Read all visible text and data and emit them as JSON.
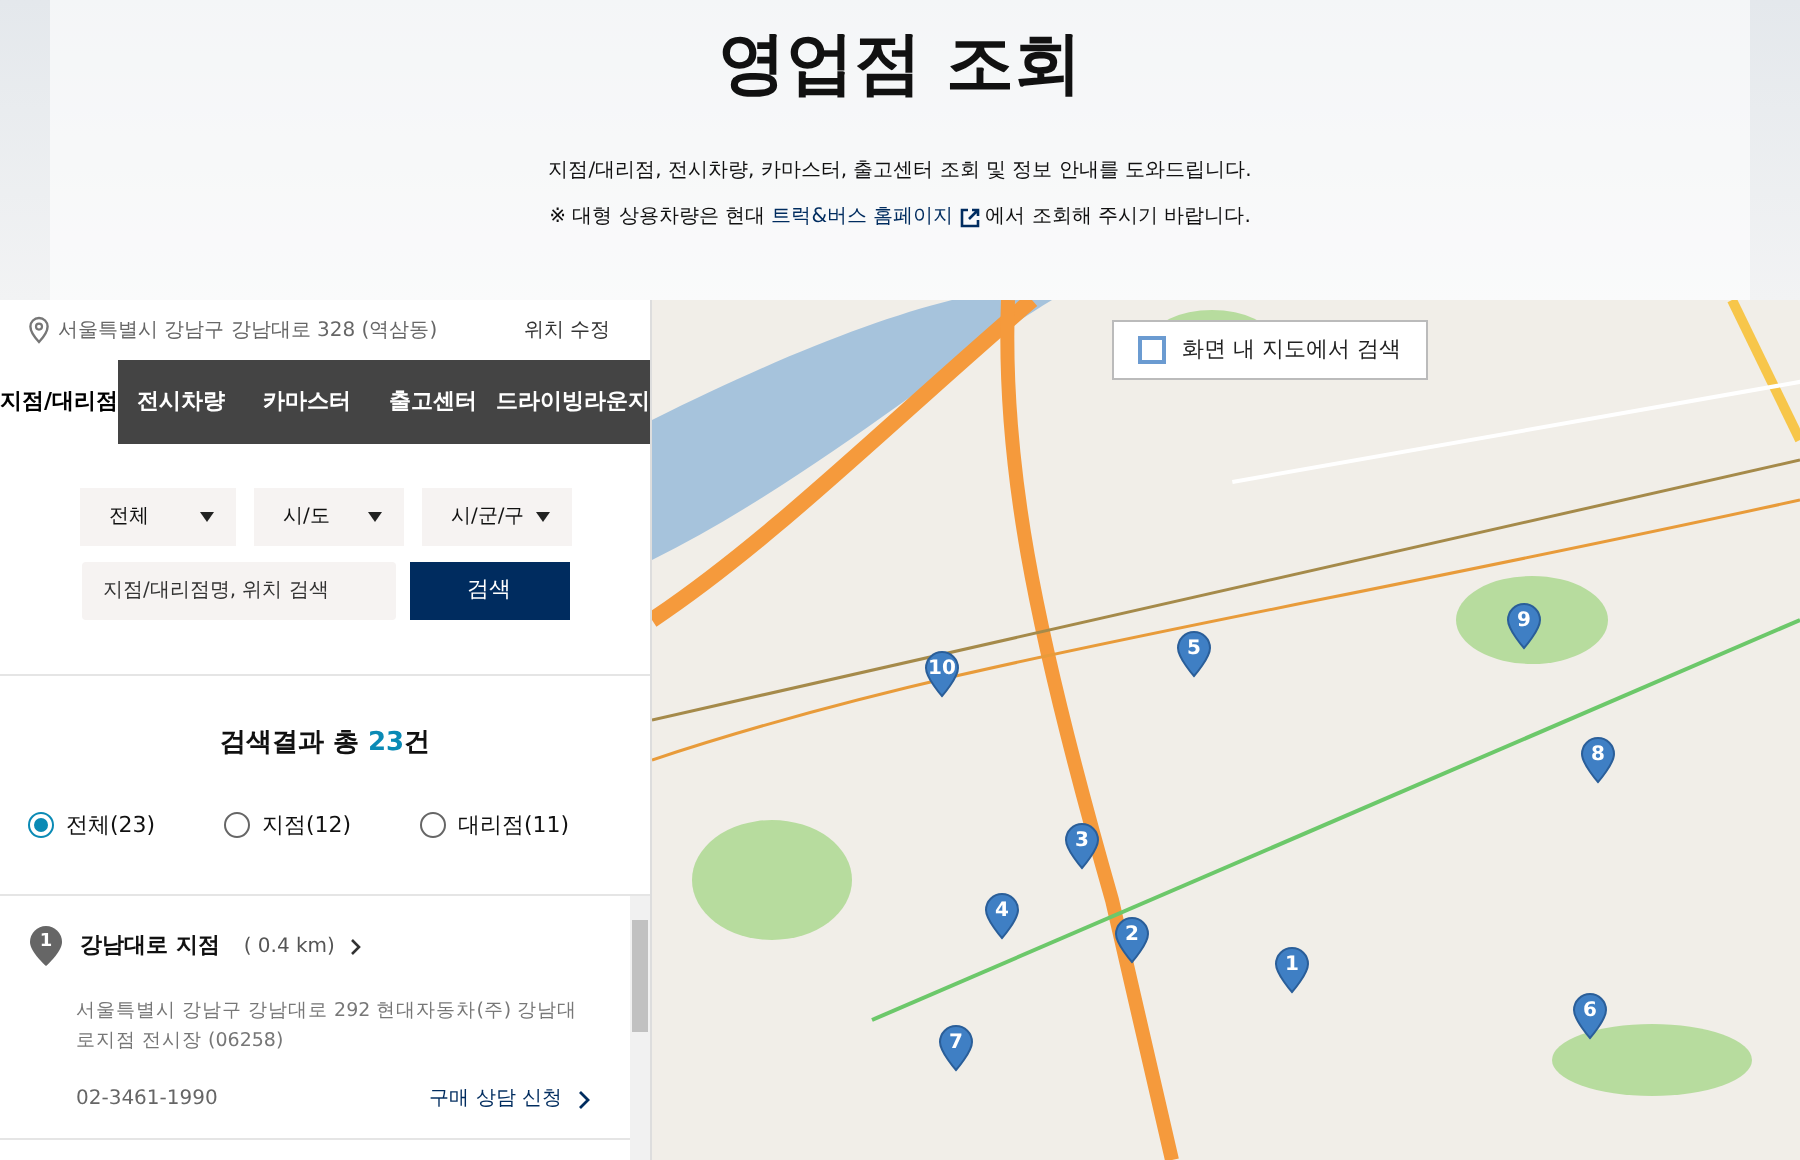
{
  "header": {
    "title": "영업점 조회",
    "description": "지점/대리점, 전시차량, 카마스터, 출고센터 조회 및 정보 안내를 도와드립니다.",
    "notice_prefix": "※ 대형 상용차량은 현대 ",
    "notice_link": "트럭&버스 홈페이지",
    "notice_suffix": "에서 조회해 주시기 바랍니다."
  },
  "location": {
    "address": "서울특별시 강남구 강남대로 328 (역삼동)",
    "edit_link": "위치 수정"
  },
  "tabs": [
    {
      "label": "지점/대리점",
      "selected": true
    },
    {
      "label": "전시차량",
      "selected": false
    },
    {
      "label": "카마스터",
      "selected": false
    },
    {
      "label": "출고센터",
      "selected": false
    },
    {
      "label": "드라이빙라운지",
      "selected": false
    }
  ],
  "filters": {
    "selects": [
      "전체",
      "시/도",
      "시/군/구"
    ],
    "search_placeholder": "지점/대리점명, 위치 검색",
    "search_button": "검색"
  },
  "results": {
    "prefix": "검색결과 총 ",
    "count": "23",
    "suffix": "건"
  },
  "result_types": [
    {
      "label": "전체(23)",
      "selected": true
    },
    {
      "label": "지점(12)",
      "selected": false
    },
    {
      "label": "대리점(11)",
      "selected": false
    }
  ],
  "branches": [
    {
      "number": "1",
      "name": "강남대로 지점",
      "distance": "( 0.4 km)",
      "address": "서울특별시 강남구 강남대로 292 현대자동차(주) 강남대로지점 전시장 (06258)",
      "phone": "02-3461-1990",
      "action": "구매 상담 신청"
    }
  ],
  "map": {
    "checkbox_label": "화면 내 지도에서 검색",
    "checked": false,
    "markers": [
      "1",
      "2",
      "3",
      "4",
      "5",
      "6",
      "7",
      "8",
      "9",
      "10"
    ]
  }
}
